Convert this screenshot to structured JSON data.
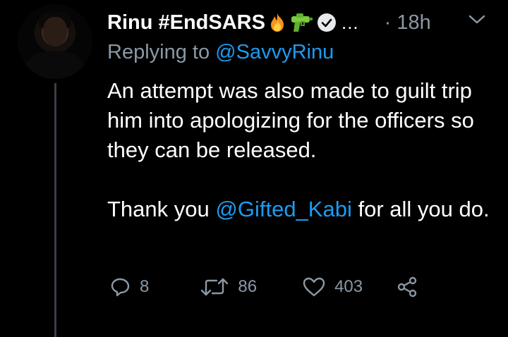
{
  "author": {
    "display_name": "Rinu #EndSARS",
    "time_ago": "18h"
  },
  "reply": {
    "prefix": "Replying to",
    "handle": "@SavvyRinu"
  },
  "tweet": {
    "line1": "An attempt was also made to guilt trip him into apologizing for the officers so they can be released.",
    "line2_before": "Thank you",
    "line2_mention": "@Gifted_Kabi",
    "line2_after": "for all you do."
  },
  "stats": {
    "replies": "8",
    "retweets": "86",
    "likes": "403"
  },
  "icons": {
    "fire": "fire-emoji",
    "water_gun": "water-pistol-emoji",
    "verified": "verified-badge",
    "more": "ellipsis",
    "chevron": "chevron-down",
    "reply": "reply-icon",
    "retweet": "retweet-icon",
    "like": "heart-icon",
    "share": "share-icon"
  },
  "colors": {
    "background": "#000000",
    "text": "#ffffff",
    "muted": "#8b98a5",
    "link": "#1d9bf0"
  }
}
